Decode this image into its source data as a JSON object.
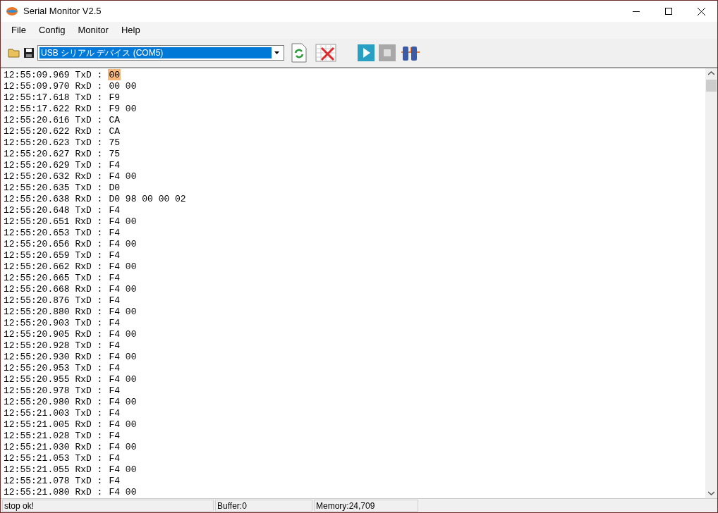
{
  "window": {
    "title": "Serial Monitor V2.5"
  },
  "menu": [
    "File",
    "Config",
    "Monitor",
    "Help"
  ],
  "toolbar": {
    "port": "USB シリアル デバイス (COM5)"
  },
  "log": [
    {
      "head": "12:55:09.969 TxD :",
      "data": "00",
      "highlighted": true
    },
    {
      "head": "12:55:09.970 RxD :",
      "data": "00 00",
      "highlighted": false
    },
    {
      "head": "12:55:17.618 TxD :",
      "data": "F9",
      "highlighted": false
    },
    {
      "head": "12:55:17.622 RxD :",
      "data": "F9 00",
      "highlighted": false
    },
    {
      "head": "12:55:20.616 TxD :",
      "data": "CA",
      "highlighted": false
    },
    {
      "head": "12:55:20.622 RxD :",
      "data": "CA",
      "highlighted": false
    },
    {
      "head": "12:55:20.623 TxD :",
      "data": "75",
      "highlighted": false
    },
    {
      "head": "12:55:20.627 RxD :",
      "data": "75",
      "highlighted": false
    },
    {
      "head": "12:55:20.629 TxD :",
      "data": "F4",
      "highlighted": false
    },
    {
      "head": "12:55:20.632 RxD :",
      "data": "F4 00",
      "highlighted": false
    },
    {
      "head": "12:55:20.635 TxD :",
      "data": "D0",
      "highlighted": false
    },
    {
      "head": "12:55:20.638 RxD :",
      "data": "D0 98 00 00 02",
      "highlighted": false
    },
    {
      "head": "12:55:20.648 TxD :",
      "data": "F4",
      "highlighted": false
    },
    {
      "head": "12:55:20.651 RxD :",
      "data": "F4 00",
      "highlighted": false
    },
    {
      "head": "12:55:20.653 TxD :",
      "data": "F4",
      "highlighted": false
    },
    {
      "head": "12:55:20.656 RxD :",
      "data": "F4 00",
      "highlighted": false
    },
    {
      "head": "12:55:20.659 TxD :",
      "data": "F4",
      "highlighted": false
    },
    {
      "head": "12:55:20.662 RxD :",
      "data": "F4 00",
      "highlighted": false
    },
    {
      "head": "12:55:20.665 TxD :",
      "data": "F4",
      "highlighted": false
    },
    {
      "head": "12:55:20.668 RxD :",
      "data": "F4 00",
      "highlighted": false
    },
    {
      "head": "12:55:20.876 TxD :",
      "data": "F4",
      "highlighted": false
    },
    {
      "head": "12:55:20.880 RxD :",
      "data": "F4 00",
      "highlighted": false
    },
    {
      "head": "12:55:20.903 TxD :",
      "data": "F4",
      "highlighted": false
    },
    {
      "head": "12:55:20.905 RxD :",
      "data": "F4 00",
      "highlighted": false
    },
    {
      "head": "12:55:20.928 TxD :",
      "data": "F4",
      "highlighted": false
    },
    {
      "head": "12:55:20.930 RxD :",
      "data": "F4 00",
      "highlighted": false
    },
    {
      "head": "12:55:20.953 TxD :",
      "data": "F4",
      "highlighted": false
    },
    {
      "head": "12:55:20.955 RxD :",
      "data": "F4 00",
      "highlighted": false
    },
    {
      "head": "12:55:20.978 TxD :",
      "data": "F4",
      "highlighted": false
    },
    {
      "head": "12:55:20.980 RxD :",
      "data": "F4 00",
      "highlighted": false
    },
    {
      "head": "12:55:21.003 TxD :",
      "data": "F4",
      "highlighted": false
    },
    {
      "head": "12:55:21.005 RxD :",
      "data": "F4 00",
      "highlighted": false
    },
    {
      "head": "12:55:21.028 TxD :",
      "data": "F4",
      "highlighted": false
    },
    {
      "head": "12:55:21.030 RxD :",
      "data": "F4 00",
      "highlighted": false
    },
    {
      "head": "12:55:21.053 TxD :",
      "data": "F4",
      "highlighted": false
    },
    {
      "head": "12:55:21.055 RxD :",
      "data": "F4 00",
      "highlighted": false
    },
    {
      "head": "12:55:21.078 TxD :",
      "data": "F4",
      "highlighted": false
    },
    {
      "head": "12:55:21.080 RxD :",
      "data": "F4 00",
      "highlighted": false
    }
  ],
  "status_bar": [
    "stop ok!",
    "Buffer:0",
    "Memory:24,709"
  ]
}
